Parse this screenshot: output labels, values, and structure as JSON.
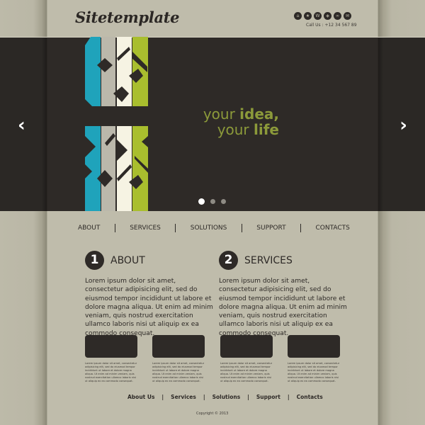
{
  "header": {
    "logo": "Sitetemplate",
    "call_us": "Call Us : +12 34 567 89",
    "social_icons": [
      {
        "name": "home-icon",
        "glyph": "⌂"
      },
      {
        "name": "star-icon",
        "glyph": "★"
      },
      {
        "name": "wordpress-icon",
        "glyph": "W"
      },
      {
        "name": "share-icon",
        "glyph": "◈"
      },
      {
        "name": "flickr-icon",
        "glyph": "∞"
      },
      {
        "name": "mail-icon",
        "glyph": "✉"
      }
    ]
  },
  "slider": {
    "headline_line1_light": "your ",
    "headline_line1_bold": "idea,",
    "headline_line2_light": "your ",
    "headline_line2_bold": "life",
    "prev_glyph": "‹",
    "next_glyph": "›",
    "slide_count": 3,
    "active_slide": 1,
    "colors": {
      "teal": "#1fa3bb",
      "grey": "#bbb8ab",
      "cream": "#f6f3e3",
      "lime": "#a9be2e",
      "headline": "#8c9a3a"
    }
  },
  "nav": {
    "items": [
      "ABOUT",
      "SERVICES",
      "SOLUTIONS",
      "SUPPORT",
      "CONTACTS"
    ]
  },
  "sections": [
    {
      "number": "1",
      "title": "ABOUT",
      "body": "Lorem ipsum dolor sit amet, consectetur adipisicing elit, sed do eiusmod tempor incididunt ut labore et dolore magna aliqua. Ut enim ad minim veniam, quis nostrud exercitation ullamco laboris nisi ut aliquip ex ea commodo consequat."
    },
    {
      "number": "2",
      "title": "SERVICES",
      "body": "Lorem ipsum dolor sit amet, consectetur adipisicing elit, sed do eiusmod tempor incididunt ut labore et dolore magna aliqua. Ut enim ad minim veniam, quis nostrud exercitation ullamco laboris nisi ut aliquip ex ea commodo consequat."
    }
  ],
  "cards": [
    {
      "body": "Lorem ipsum dolor sit amet, consectetur adipisicing elit, sed do eiusmod tempor incididunt ut labore et dolore magna aliqua. Ut enim ad minim veniam, quis nostrud exercitation ullamco laboris nisi ut aliquip ex ea commodo consequat."
    },
    {
      "body": "Lorem ipsum dolor sit amet, consectetur adipisicing elit, sed do eiusmod tempor incididunt ut labore et dolore magna aliqua. Ut enim ad minim veniam, quis nostrud exercitation ullamco laboris nisi ut aliquip ex ea commodo consequat."
    },
    {
      "body": "Lorem ipsum dolor sit amet, consectetur adipisicing elit, sed do eiusmod tempor incididunt ut labore et dolore magna aliqua. Ut enim ad minim veniam, quis nostrud exercitation ullamco laboris nisi ut aliquip ex ea commodo consequat."
    },
    {
      "body": "Lorem ipsum dolor sit amet, consectetur adipisicing elit, sed do eiusmod tempor incididunt ut labore et dolore magna aliqua. Ut enim ad minim veniam, quis nostrud exercitation ullamco laboris nisi ut aliquip ex ea commodo consequat."
    }
  ],
  "footer": {
    "links": [
      "About Us",
      "Services",
      "Solutions",
      "Support",
      "Contacts"
    ],
    "separator": "|",
    "copyright": "Copyright © 2013"
  }
}
